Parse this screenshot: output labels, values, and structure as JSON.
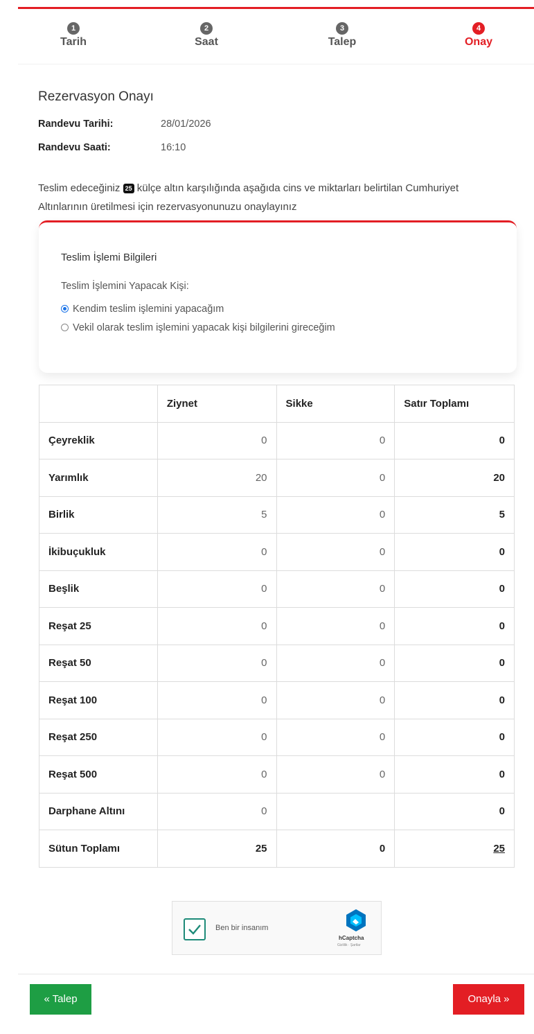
{
  "stepper": {
    "steps": [
      {
        "num": "1",
        "label": "Tarih"
      },
      {
        "num": "2",
        "label": "Saat"
      },
      {
        "num": "3",
        "label": "Talep"
      },
      {
        "num": "4",
        "label": "Onay"
      }
    ],
    "active_index": 3
  },
  "page": {
    "title": "Rezervasyon Onayı",
    "date_label": "Randevu Tarihi:",
    "date_value": "28/01/2026",
    "time_label": "Randevu Saati:",
    "time_value": "16:10",
    "desc_before": "Teslim edeceğiniz",
    "desc_badge": "25",
    "desc_after": "külçe altın karşılığında aşağıda cins ve miktarları belirtilan Cumhuriyet Altınlarının üretilmesi için rezervasyonunuzu onaylayınız"
  },
  "panel": {
    "title": "Teslim İşlemi Bilgileri",
    "question": "Teslim İşlemini Yapacak Kişi:",
    "option_self": "Kendim teslim işlemini yapacağım",
    "option_proxy": "Vekil olarak teslim işlemini yapacak kişi bilgilerini gireceğim",
    "selected": "self"
  },
  "table": {
    "headers": [
      "",
      "Ziynet",
      "Sikke",
      "Satır Toplamı"
    ],
    "rows": [
      {
        "name": "Çeyreklik",
        "ziynet": "0",
        "sikke": "0",
        "total": "0"
      },
      {
        "name": "Yarımlık",
        "ziynet": "20",
        "sikke": "0",
        "total": "20"
      },
      {
        "name": "Birlik",
        "ziynet": "5",
        "sikke": "0",
        "total": "5"
      },
      {
        "name": "İkibuçukluk",
        "ziynet": "0",
        "sikke": "0",
        "total": "0"
      },
      {
        "name": "Beşlik",
        "ziynet": "0",
        "sikke": "0",
        "total": "0"
      },
      {
        "name": "Reşat 25",
        "ziynet": "0",
        "sikke": "0",
        "total": "0"
      },
      {
        "name": "Reşat 50",
        "ziynet": "0",
        "sikke": "0",
        "total": "0"
      },
      {
        "name": "Reşat 100",
        "ziynet": "0",
        "sikke": "0",
        "total": "0"
      },
      {
        "name": "Reşat 250",
        "ziynet": "0",
        "sikke": "0",
        "total": "0"
      },
      {
        "name": "Reşat 500",
        "ziynet": "0",
        "sikke": "0",
        "total": "0"
      },
      {
        "name": "Darphane Altını",
        "ziynet": "0",
        "sikke": "",
        "total": "0"
      }
    ],
    "sum": {
      "name": "Sütun Toplamı",
      "ziynet": "25",
      "sikke": "0",
      "total": "25"
    }
  },
  "captcha": {
    "label": "Ben bir insanım",
    "brand": "hCaptcha",
    "sub": "Gizlilik · Şartlar"
  },
  "footer": {
    "back_label": "« Talep",
    "next_label": "Onayla »"
  },
  "colors": {
    "accent": "#e31e24",
    "back_button": "#1e9e44",
    "radio": "#1a73e8"
  }
}
